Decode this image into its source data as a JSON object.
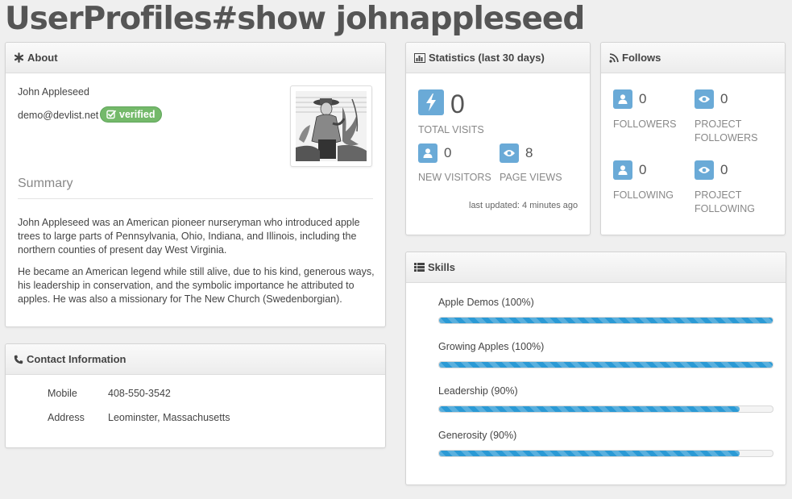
{
  "page": {
    "title": "UserProfiles#show johnappleseed"
  },
  "about": {
    "heading": "About",
    "name": "John Appleseed",
    "email": "demo@devlist.net",
    "verified_label": "verified",
    "summary_heading": "Summary",
    "summary_paragraphs": [
      "John Appleseed was an American pioneer nurseryman who introduced apple trees to large parts of Pennsylvania, Ohio, Indiana, and Illinois, including the northern counties of present day West Virginia.",
      "He became an American legend while still alive, due to his kind, generous ways, his leadership in conservation, and the symbolic importance he attributed to apples. He was also a missionary for The New Church (Swedenborgian)."
    ]
  },
  "contact": {
    "heading": "Contact Information",
    "rows": [
      {
        "label": "Mobile",
        "value": "408-550-3542"
      },
      {
        "label": "Address",
        "value": "Leominster, Massachusetts"
      }
    ]
  },
  "statistics": {
    "heading": "Statistics (last 30 days)",
    "total_visits": {
      "value": "0",
      "label": "TOTAL VISITS",
      "icon": "bolt-icon"
    },
    "new_visitors": {
      "value": "0",
      "label": "NEW VISITORS",
      "icon": "user-icon"
    },
    "page_views": {
      "value": "8",
      "label": "PAGE VIEWS",
      "icon": "eye-icon"
    },
    "last_updated": "last updated: 4 minutes ago"
  },
  "follows": {
    "heading": "Follows",
    "items": [
      {
        "value": "0",
        "label_line1": "FOLLOWERS",
        "label_line2": "",
        "icon": "user-icon"
      },
      {
        "value": "0",
        "label_line1": "PROJECT",
        "label_line2": "FOLLOWERS",
        "icon": "eye-icon"
      },
      {
        "value": "0",
        "label_line1": "FOLLOWING",
        "label_line2": "",
        "icon": "user-icon"
      },
      {
        "value": "0",
        "label_line1": "PROJECT",
        "label_line2": "FOLLOWING",
        "icon": "eye-icon"
      }
    ]
  },
  "skills": {
    "heading": "Skills",
    "items": [
      {
        "label": "Apple Demos (100%)",
        "percent": 100
      },
      {
        "label": "Growing Apples (100%)",
        "percent": 100
      },
      {
        "label": "Leadership (90%)",
        "percent": 90
      },
      {
        "label": "Generosity (90%)",
        "percent": 90
      }
    ]
  },
  "colors": {
    "accent_blue": "#6aaad7",
    "progress_blue": "#2b9ad5",
    "verified_green": "#74b96a"
  }
}
